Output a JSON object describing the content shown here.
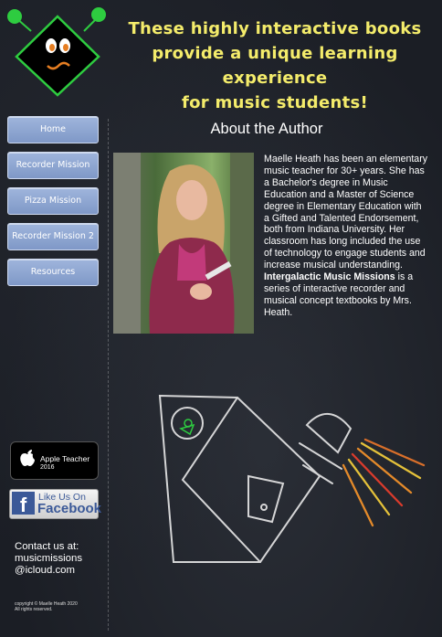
{
  "header": {
    "tagline": [
      "These highly interactive books",
      "provide a unique learning experience",
      "for music students!"
    ],
    "logo_icon": "alien-eyes-logo"
  },
  "nav": {
    "items": [
      {
        "label": "Home"
      },
      {
        "label": "Recorder Mission"
      },
      {
        "label": "Pizza Mission"
      },
      {
        "label": "Recorder Mission 2"
      },
      {
        "label": "Resources"
      }
    ]
  },
  "main": {
    "title": "About the Author",
    "bio_intro": "Maelle Heath has been an elementary music teacher for 30+ years.  She has a Bachelor's degree in Music Education and a Master of Science degree in Elementary Education with a Gifted and Talented Endorsement, both from Indiana University.  Her classroom has long included the use of technology to engage students and increase musical understanding.",
    "bio_book": "Intergalactic Music Missions",
    "bio_outro": "is a series of interactive recorder and musical concept textbooks by Mrs. Heath.",
    "illustration_icon": "chalk-rocket-icon"
  },
  "badges": {
    "apple_line1": "Apple Teacher",
    "apple_line2": "2016",
    "facebook_line1": "Like Us On",
    "facebook_line2": "Facebook"
  },
  "contact": {
    "line1": "Contact us at:",
    "line2": "musicmissions",
    "line3": "@icloud.com"
  },
  "footer": {
    "copyright": "copyright © Maelle Heath 2020",
    "rights": "All rights reserved."
  },
  "colors": {
    "tagline": "#f4ec6b",
    "nav_button": "#8fa7d4",
    "logo_green": "#2ecc40"
  }
}
